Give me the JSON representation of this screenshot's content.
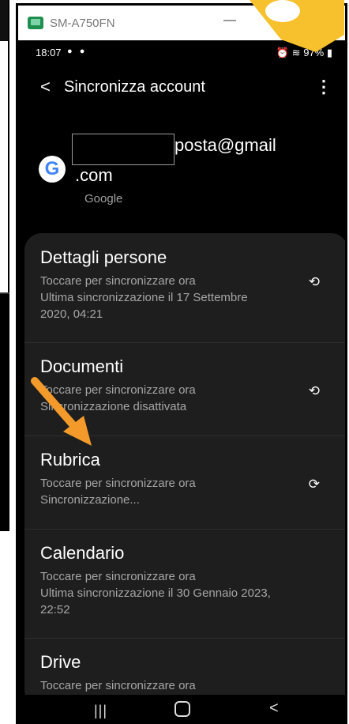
{
  "window": {
    "title": "SM-A750FN"
  },
  "statusbar": {
    "time": "18:07",
    "battery": "97%"
  },
  "header": {
    "title": "Sincronizza account"
  },
  "account": {
    "email_line1": "posta@gmail",
    "email_line2": ".com",
    "provider": "Google"
  },
  "sync_items": [
    {
      "name": "Dettagli persone",
      "line1": "Toccare per sincronizzare ora",
      "line2": "Ultima sincronizzazione il 17 Settembre 2020, 04:21"
    },
    {
      "name": "Documenti",
      "line1": "Toccare per sincronizzare ora",
      "line2": "Sincronizzazione disattivata"
    },
    {
      "name": "Rubrica",
      "line1": "Toccare per sincronizzare ora",
      "line2": "Sincronizzazione..."
    },
    {
      "name": "Calendario",
      "line1": "Toccare per sincronizzare ora",
      "line2": "Ultima sincronizzazione il 30 Gennaio 2023, 22:52"
    },
    {
      "name": "Drive",
      "line1": "Toccare per sincronizzare ora",
      "line2": ""
    }
  ],
  "colors": {
    "accent_arrow": "#f39a2b",
    "badge_yellow": "#f6c12c"
  },
  "icons": {
    "back": "back-arrow-icon",
    "more": "more-vert-icon",
    "sync": "sync-icon",
    "google": "google-logo-icon"
  }
}
